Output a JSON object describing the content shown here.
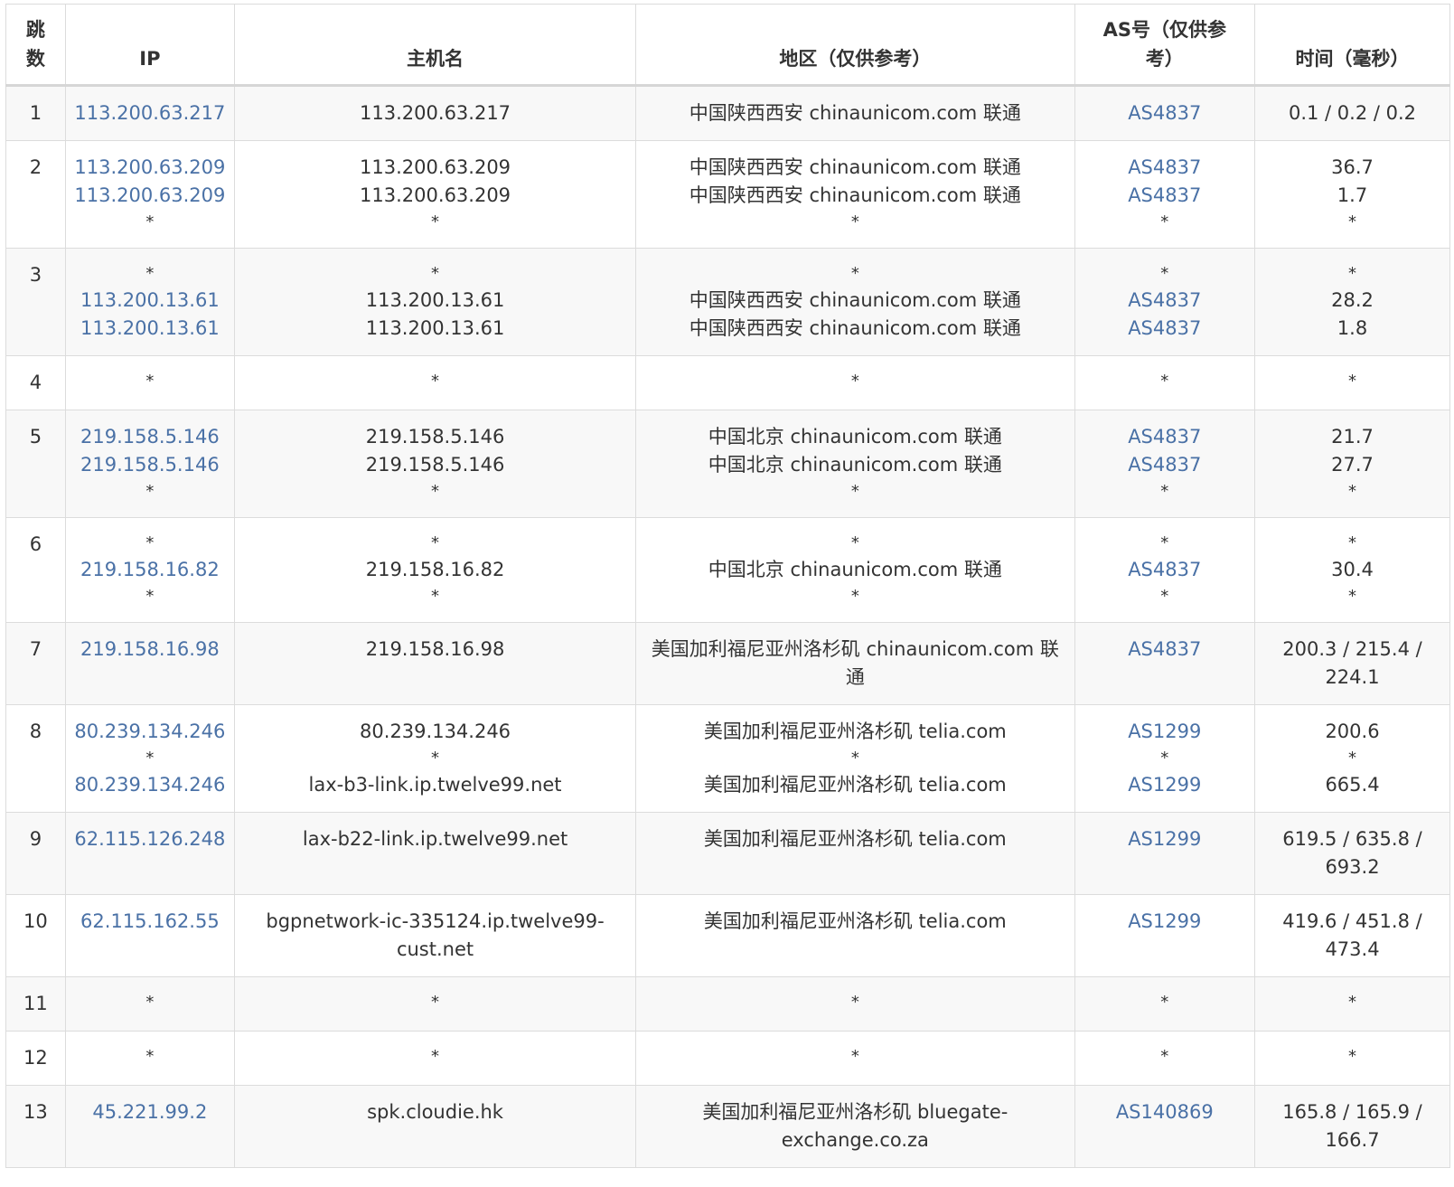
{
  "headers": {
    "hop": "跳数",
    "ip": "IP",
    "host": "主机名",
    "region": "地区（仅供参考）",
    "asn": "AS号（仅供参考）",
    "time": "时间（毫秒）"
  },
  "rows": [
    {
      "hop": "1",
      "ip": [
        "113.200.63.217"
      ],
      "host": [
        "113.200.63.217"
      ],
      "region": [
        "中国陕西西安 chinaunicom.com 联通"
      ],
      "asn": [
        "AS4837"
      ],
      "time": [
        "0.1 / 0.2 / 0.2"
      ]
    },
    {
      "hop": "2",
      "ip": [
        "113.200.63.209",
        "113.200.63.209",
        "*"
      ],
      "host": [
        "113.200.63.209",
        "113.200.63.209",
        "*"
      ],
      "region": [
        "中国陕西西安 chinaunicom.com 联通",
        "中国陕西西安 chinaunicom.com 联通",
        "*"
      ],
      "asn": [
        "AS4837",
        "AS4837",
        "*"
      ],
      "time": [
        "36.7",
        "1.7",
        "*"
      ]
    },
    {
      "hop": "3",
      "ip": [
        "*",
        "113.200.13.61",
        "113.200.13.61"
      ],
      "host": [
        "*",
        "113.200.13.61",
        "113.200.13.61"
      ],
      "region": [
        "*",
        "中国陕西西安 chinaunicom.com 联通",
        "中国陕西西安 chinaunicom.com 联通"
      ],
      "asn": [
        "*",
        "AS4837",
        "AS4837"
      ],
      "time": [
        "*",
        "28.2",
        "1.8"
      ]
    },
    {
      "hop": "4",
      "ip": [
        "*"
      ],
      "host": [
        "*"
      ],
      "region": [
        "*"
      ],
      "asn": [
        "*"
      ],
      "time": [
        "*"
      ]
    },
    {
      "hop": "5",
      "ip": [
        "219.158.5.146",
        "219.158.5.146",
        "*"
      ],
      "host": [
        "219.158.5.146",
        "219.158.5.146",
        "*"
      ],
      "region": [
        "中国北京 chinaunicom.com 联通",
        "中国北京 chinaunicom.com 联通",
        "*"
      ],
      "asn": [
        "AS4837",
        "AS4837",
        "*"
      ],
      "time": [
        "21.7",
        "27.7",
        "*"
      ]
    },
    {
      "hop": "6",
      "ip": [
        "*",
        "219.158.16.82",
        "*"
      ],
      "host": [
        "*",
        "219.158.16.82",
        "*"
      ],
      "region": [
        "*",
        "中国北京 chinaunicom.com 联通",
        "*"
      ],
      "asn": [
        "*",
        "AS4837",
        "*"
      ],
      "time": [
        "*",
        "30.4",
        "*"
      ]
    },
    {
      "hop": "7",
      "ip": [
        "219.158.16.98"
      ],
      "host": [
        "219.158.16.98"
      ],
      "region": [
        "美国加利福尼亚州洛杉矶 chinaunicom.com 联通"
      ],
      "asn": [
        "AS4837"
      ],
      "time": [
        "200.3 / 215.4 / 224.1"
      ]
    },
    {
      "hop": "8",
      "ip": [
        "80.239.134.246",
        "*",
        "80.239.134.246"
      ],
      "host": [
        "80.239.134.246",
        "*",
        "lax-b3-link.ip.twelve99.net"
      ],
      "region": [
        "美国加利福尼亚州洛杉矶 telia.com",
        "*",
        "美国加利福尼亚州洛杉矶 telia.com"
      ],
      "asn": [
        "AS1299",
        "*",
        "AS1299"
      ],
      "time": [
        "200.6",
        "*",
        "665.4"
      ]
    },
    {
      "hop": "9",
      "ip": [
        "62.115.126.248"
      ],
      "host": [
        "lax-b22-link.ip.twelve99.net"
      ],
      "region": [
        "美国加利福尼亚州洛杉矶 telia.com"
      ],
      "asn": [
        "AS1299"
      ],
      "time": [
        "619.5 / 635.8 / 693.2"
      ]
    },
    {
      "hop": "10",
      "ip": [
        "62.115.162.55"
      ],
      "host": [
        "bgpnetwork-ic-335124.ip.twelve99-cust.net"
      ],
      "region": [
        "美国加利福尼亚州洛杉矶 telia.com"
      ],
      "asn": [
        "AS1299"
      ],
      "time": [
        "419.6 / 451.8 / 473.4"
      ]
    },
    {
      "hop": "11",
      "ip": [
        "*"
      ],
      "host": [
        "*"
      ],
      "region": [
        "*"
      ],
      "asn": [
        "*"
      ],
      "time": [
        "*"
      ]
    },
    {
      "hop": "12",
      "ip": [
        "*"
      ],
      "host": [
        "*"
      ],
      "region": [
        "*"
      ],
      "asn": [
        "*"
      ],
      "time": [
        "*"
      ]
    },
    {
      "hop": "13",
      "ip": [
        "45.221.99.2"
      ],
      "host": [
        "spk.cloudie.hk"
      ],
      "region": [
        "美国加利福尼亚州洛杉矶 bluegate-exchange.co.za"
      ],
      "asn": [
        "AS140869"
      ],
      "time": [
        "165.8 / 165.9 / 166.7"
      ]
    }
  ]
}
